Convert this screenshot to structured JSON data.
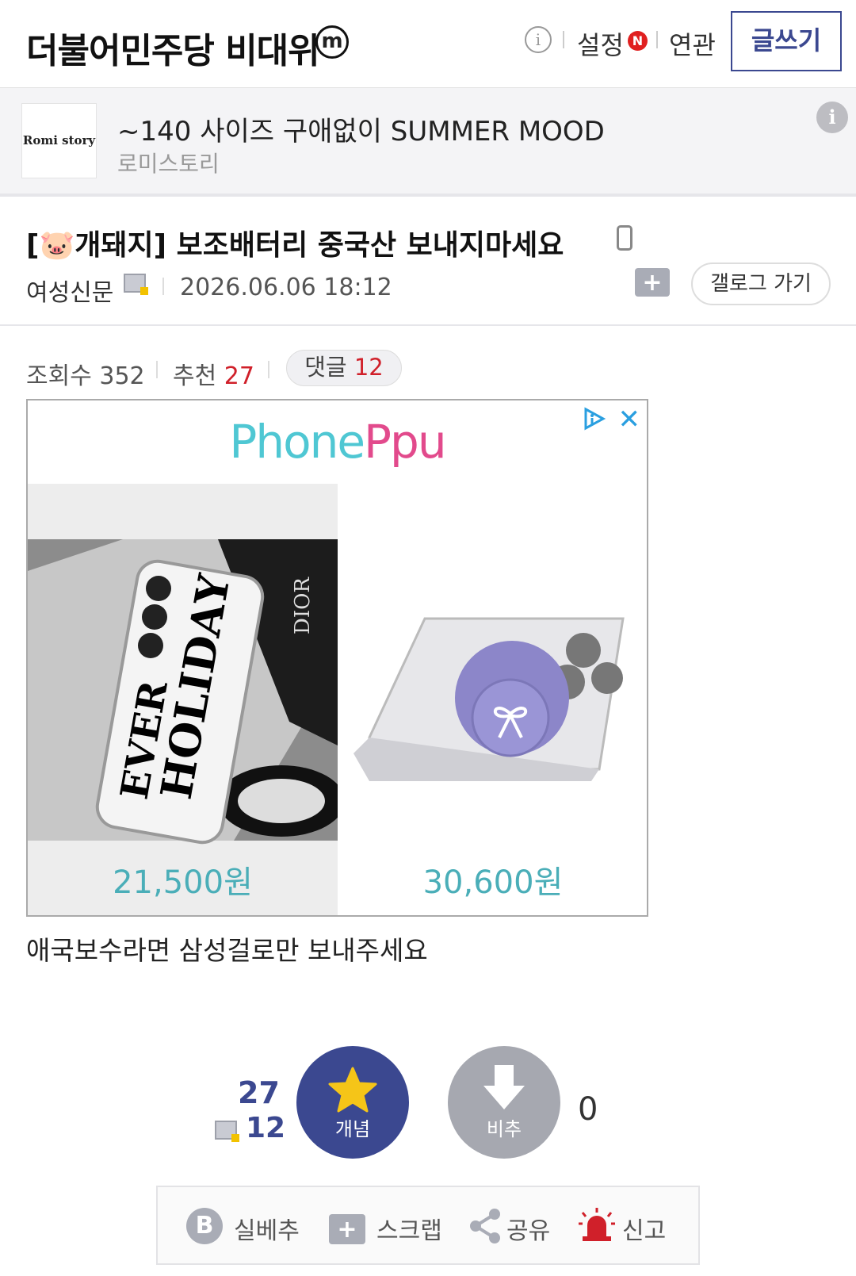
{
  "header": {
    "gallery_title": "더불어민주당 비대위",
    "minor_badge": "m",
    "settings_label": "설정",
    "new_badge": "N",
    "related_label": "연관",
    "write_label": "글쓰기"
  },
  "top_ad": {
    "logo_text": "Romi story",
    "title": "~140 사이즈 구애없이 SUMMER MOOD",
    "advertiser": "로미스토리"
  },
  "post": {
    "title": "[🐷개돼지] 보조배터리 중국산 보내지마세요",
    "author": "여성신문",
    "date": "2026.06.06 18:12",
    "gallog_button": "갤로그 가기",
    "stats": {
      "views_label": "조회수",
      "views": "352",
      "rec_label": "추천",
      "rec": "27",
      "comments_label": "댓글",
      "comments": "12"
    },
    "body": "애국보수라면 삼성걸로만 보내주세요"
  },
  "ad": {
    "brand_a": "Phone",
    "brand_b": "Ppu",
    "products": [
      {
        "price": "21,500원"
      },
      {
        "price": "30,600원"
      }
    ]
  },
  "votes": {
    "up_count": "27",
    "fixed_up_count": "12",
    "up_label": "개념",
    "down_label": "비추",
    "down_count": "0"
  },
  "actions": {
    "best_label": "실베추",
    "scrap_label": "스크랩",
    "share_label": "공유",
    "report_label": "신고"
  },
  "colors": {
    "accent": "#3b4890",
    "red": "#d0202a",
    "price": "#4aaeb8"
  }
}
